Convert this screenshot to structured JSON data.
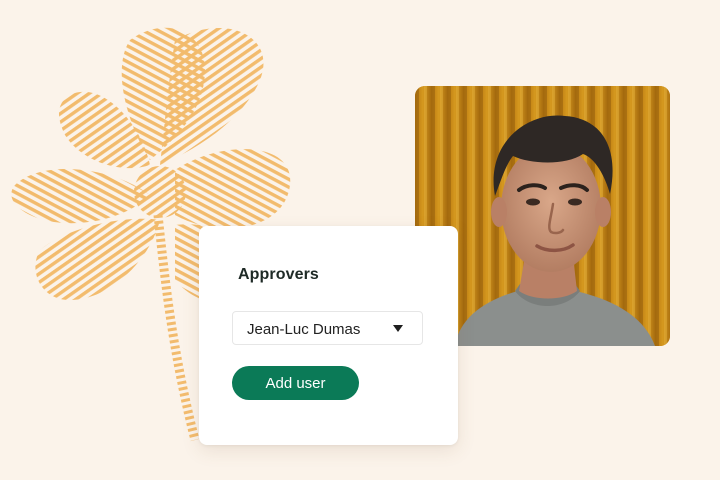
{
  "approvers_card": {
    "title": "Approvers",
    "selected_user": "Jean-Luc Dumas",
    "add_button_label": "Add user"
  },
  "icons": {
    "dropdown": "caret-down-icon",
    "decoration": "fingerprint-flower-illustration"
  },
  "colors": {
    "background": "#fbf3ea",
    "flower": "#f2b660",
    "button": "#0b7a57",
    "curtain": "#c98a17"
  }
}
